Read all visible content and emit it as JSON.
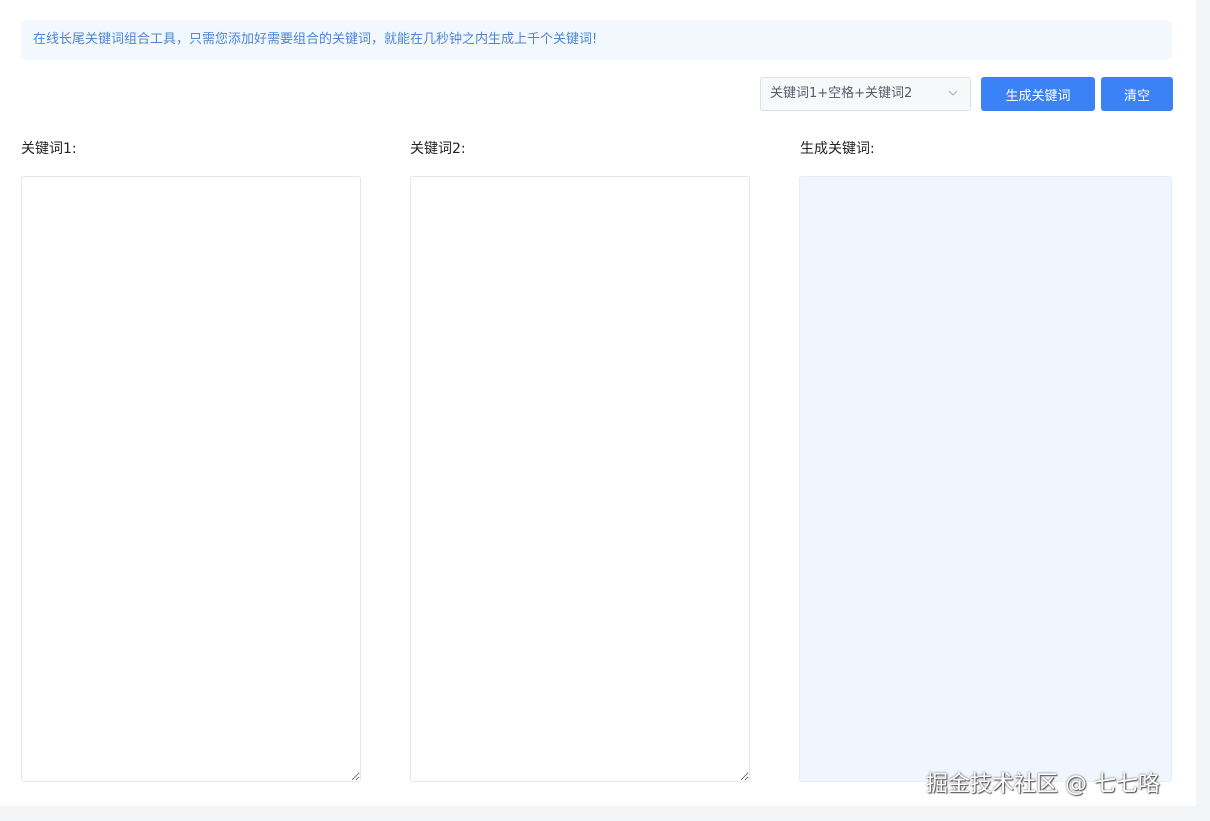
{
  "notice": {
    "text": "在线长尾关键词组合工具，只需您添加好需要组合的关键词，就能在几秒钟之内生成上千个关键词!"
  },
  "toolbar": {
    "combine_mode": {
      "selected": "关键词1+空格+关键词2",
      "icon": "chevron-down-icon"
    },
    "generate_label": "生成关键词",
    "clear_label": "清空"
  },
  "columns": {
    "keyword1": {
      "label": "关键词1:",
      "value": ""
    },
    "keyword2": {
      "label": "关键词2:",
      "value": ""
    },
    "result": {
      "label": "生成关键词:",
      "value": ""
    }
  },
  "watermark": {
    "text": "掘金技术社区 @ 七七咯"
  },
  "colors": {
    "accent": "#3b82f6",
    "notice_bg": "#f3f8ff",
    "notice_text": "#4a86d8",
    "result_bg": "#f0f6fe"
  }
}
